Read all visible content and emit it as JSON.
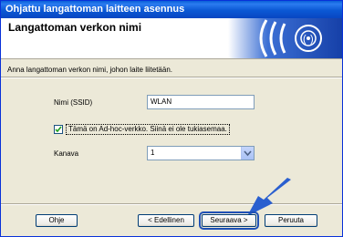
{
  "window": {
    "title": "Ohjattu langattoman laitteen asennus"
  },
  "header": {
    "title": "Langattoman verkon nimi",
    "logo_icon": "wireless-signal-icon"
  },
  "instruction": "Anna langattoman verkon nimi, johon laite liitetään.",
  "form": {
    "ssid_label": "Nimi (SSID)",
    "ssid_value": "WLAN",
    "adhoc_label": "Tämä on Ad-hoc-verkko. Siinä ei ole tukiasemaa.",
    "adhoc_checked": true,
    "channel_label": "Kanava",
    "channel_value": "1"
  },
  "buttons": {
    "help": "Ohje",
    "back": "< Edellinen",
    "next": "Seuraava >",
    "cancel": "Peruuta"
  },
  "colors": {
    "accent_arrow": "#2a5fcf",
    "titlebar": "#0a5fd8"
  }
}
